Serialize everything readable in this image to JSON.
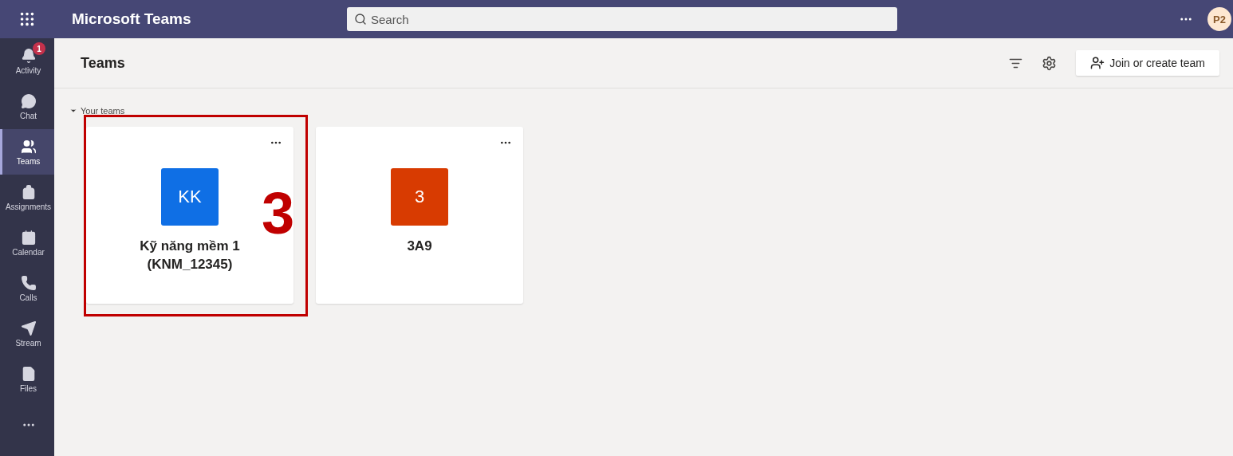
{
  "app_title": "Microsoft Teams",
  "search": {
    "placeholder": "Search"
  },
  "avatar": {
    "initials": "P2"
  },
  "rail": [
    {
      "kind": "activity",
      "label": "Activity",
      "badge": "1",
      "selected": false
    },
    {
      "kind": "chat",
      "label": "Chat",
      "selected": false
    },
    {
      "kind": "teams",
      "label": "Teams",
      "selected": true
    },
    {
      "kind": "assignments",
      "label": "Assignments",
      "selected": false
    },
    {
      "kind": "calendar",
      "label": "Calendar",
      "selected": false
    },
    {
      "kind": "calls",
      "label": "Calls",
      "selected": false
    },
    {
      "kind": "stream",
      "label": "Stream",
      "selected": false
    },
    {
      "kind": "files",
      "label": "Files",
      "selected": false
    }
  ],
  "page_title": "Teams",
  "join_button": "Join or create team",
  "section": {
    "label": "Your teams",
    "expanded": true
  },
  "teams": [
    {
      "initials": "KK",
      "name": "Kỹ năng mềm 1 (KNM_12345)",
      "color": "#0f6fe5",
      "highlighted": true
    },
    {
      "initials": "3",
      "name": "3A9",
      "color": "#d83b01",
      "highlighted": false
    }
  ],
  "annotation": {
    "step": "3"
  }
}
